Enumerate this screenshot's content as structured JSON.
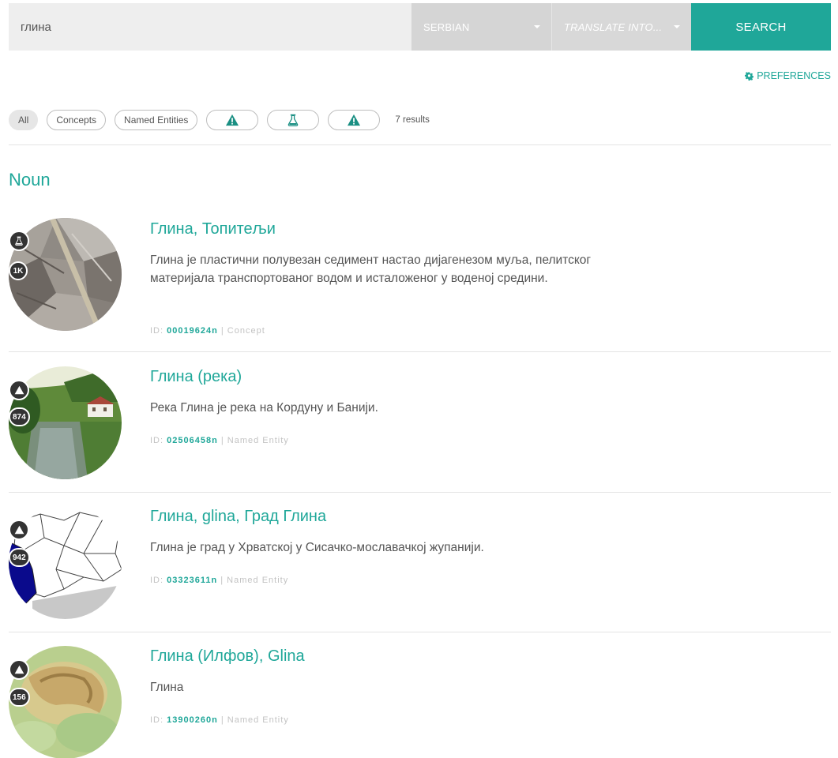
{
  "search": {
    "query": "глина",
    "source_language": "SERBIAN",
    "target_placeholder": "TRANSLATE INTO...",
    "button_label": "SEARCH"
  },
  "preferences_label": "PREFERENCES",
  "filters": {
    "all_label": "All",
    "concepts_label": "Concepts",
    "named_entities_label": "Named Entities",
    "icon_chips": [
      "warning-icon",
      "flask-icon",
      "warning-icon"
    ],
    "results_count": "7 results"
  },
  "section_heading": "Noun",
  "results": [
    {
      "title": "Глина, Топитељи",
      "description": "Глина је пластични полувезан седимент настао дијагенезом муља, пелитског материјала транспортованог водом и исталоженог у воденој средини.",
      "id_prefix": "ID:",
      "id": "00019624n",
      "separator": "|",
      "type": "Concept",
      "badge_icon": "flask-icon",
      "count": "1K"
    },
    {
      "title": "Глина (река)",
      "description": "Река Глина је река на Кордуну и Банији.",
      "id_prefix": "ID:",
      "id": "02506458n",
      "separator": "|",
      "type": "Named Entity",
      "badge_icon": "warning-icon",
      "count": "874"
    },
    {
      "title": "Глина, glina, Град Глина",
      "description": "Глина је град у Хрватској у Сисачко-мославачкој жупанији.",
      "id_prefix": "ID:",
      "id": "03323611n",
      "separator": "|",
      "type": "Named Entity",
      "badge_icon": "warning-icon",
      "count": "942"
    },
    {
      "title": "Глина (Илфов), Glina",
      "description": "Глина",
      "id_prefix": "ID:",
      "id": "13900260n",
      "separator": "|",
      "type": "Named Entity",
      "badge_icon": "warning-icon",
      "count": "156"
    }
  ],
  "colors": {
    "accent": "#1fa799",
    "badge": "#333333",
    "map_region": "#0a0a8c"
  }
}
